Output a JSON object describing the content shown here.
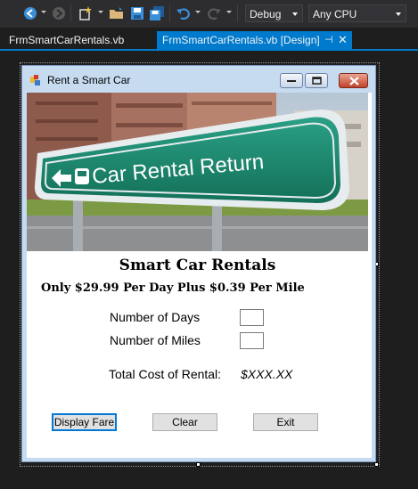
{
  "toolbar": {
    "configuration": "Debug",
    "platform": "Any CPU"
  },
  "tabs": [
    {
      "label": "FrmSmartCarRentals.vb"
    },
    {
      "label": "FrmSmartCarRentals.vb [Design]"
    }
  ],
  "form": {
    "window_title": "Rent a Smart Car",
    "banner_sign_text": "Car Rental Return",
    "heading": "Smart Car Rentals",
    "subheading": "Only $29.99 Per Day Plus $0.39 Per Mile",
    "days_label": "Number of Days",
    "miles_label": "Number of Miles",
    "total_label": "Total Cost of Rental:",
    "total_value": "$XXX.XX",
    "buttons": {
      "display_fare": "Display Fare",
      "clear": "Clear",
      "exit": "Exit"
    }
  },
  "colors": {
    "ide_background": "#1e1e1e",
    "accent": "#007acc",
    "sign_green": "#1a8a6e"
  }
}
